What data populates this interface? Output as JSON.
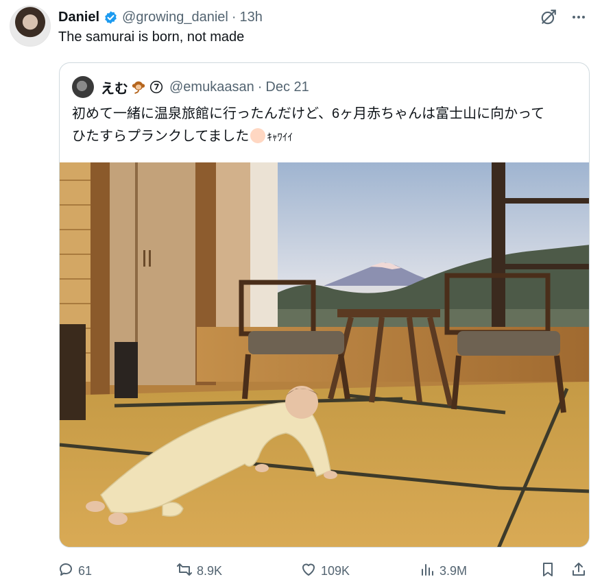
{
  "author": {
    "name": "Daniel",
    "handle": "@growing_daniel",
    "separator": "·",
    "time": "13h"
  },
  "tweet": {
    "text": "The samurai is born, not made"
  },
  "quoted": {
    "name": "えむ",
    "handle": "@emukaasan",
    "separator": "·",
    "date": "Dec 21",
    "text_line1": "初めて一緒に温泉旅館に行ったんだけど、6ヶ月赤ちゃんは富士山に向かって",
    "text_line2_prefix": "ひたすらプランクしてました",
    "text_line2_suffix": "ｷｬﾜｲｲ"
  },
  "actions": {
    "replies": "61",
    "reposts": "8.9K",
    "likes": "109K",
    "views": "3.9M"
  },
  "colors": {
    "verified": "#1d9bf0",
    "muted": "#536471",
    "border": "#cfd9de"
  },
  "icons": [
    "verified-badge-icon",
    "grok-icon",
    "more-icon",
    "reply-icon",
    "repost-icon",
    "like-icon",
    "views-icon",
    "bookmark-icon",
    "share-icon"
  ]
}
